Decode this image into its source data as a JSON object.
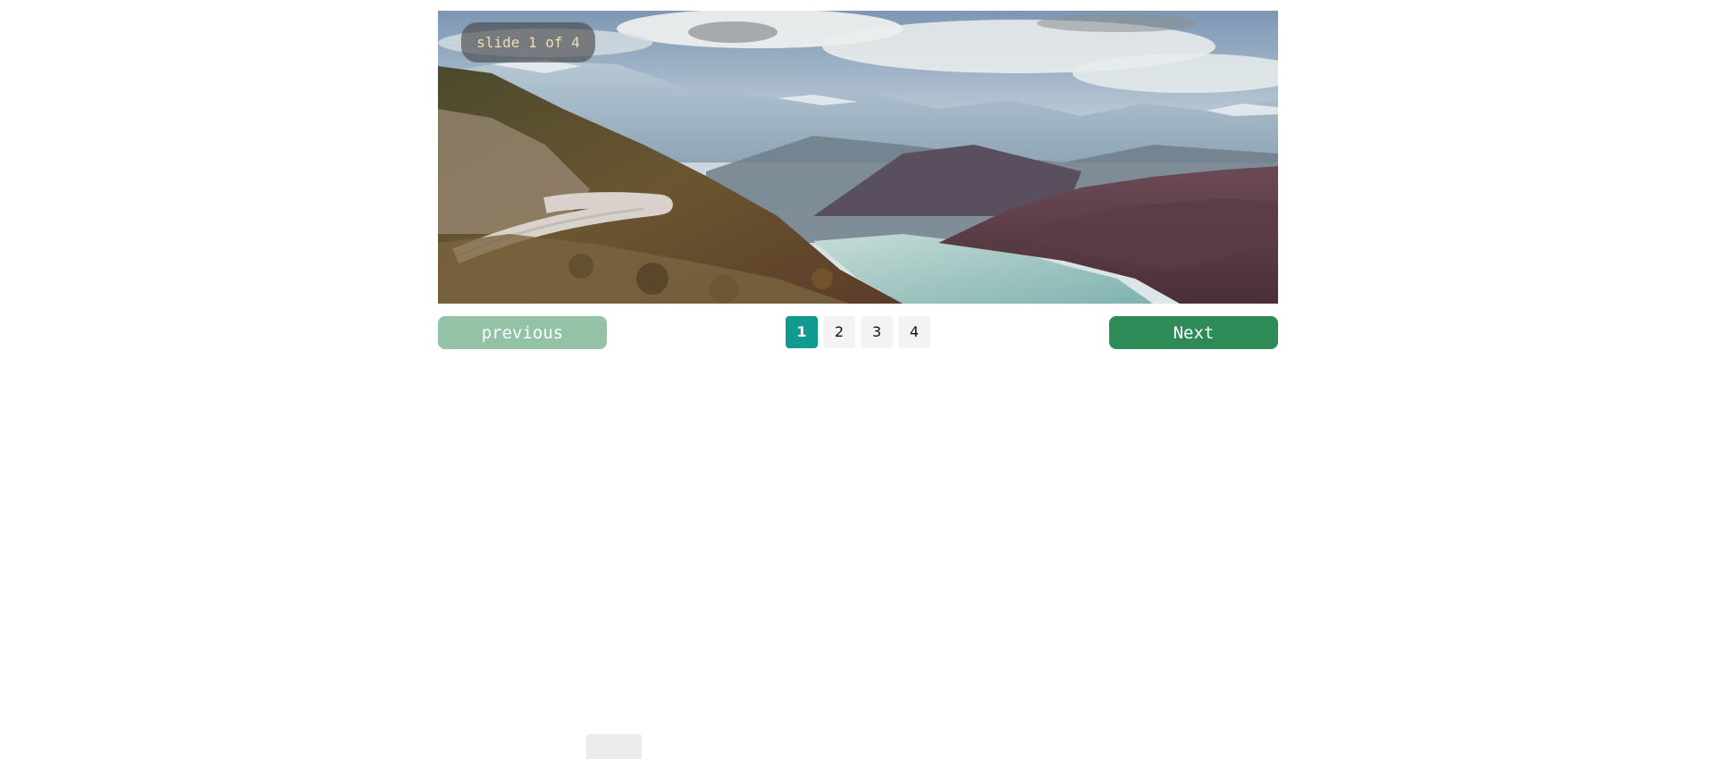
{
  "carousel": {
    "counter": "slide 1 of 4",
    "current_page": 1,
    "total_slides": 4,
    "image_description_icon": "mountain-landscape-image",
    "prev_label": "previous",
    "next_label": "Next",
    "pages": [
      "1",
      "2",
      "3",
      "4"
    ]
  },
  "colors": {
    "prev_button": "#93c2a7",
    "next_button": "#2e8b57",
    "active_page": "#119a8f",
    "inactive_page": "#f3f3f3",
    "counter_text": "#f4ddb0"
  }
}
